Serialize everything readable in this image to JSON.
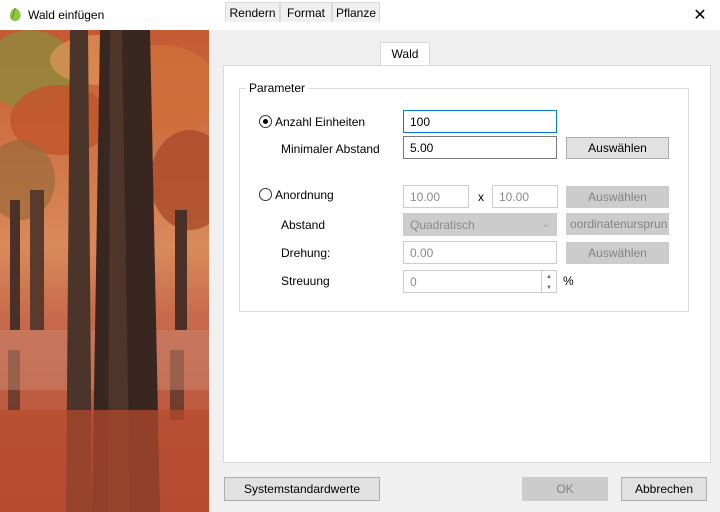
{
  "window": {
    "title": "Wald einfügen",
    "close_glyph": "✕",
    "icon": "leaf-icon"
  },
  "tabs": [
    {
      "label": "Rendern"
    },
    {
      "label": "Format"
    },
    {
      "label": "Pflanze"
    },
    {
      "label": "Wald",
      "active": true
    }
  ],
  "group": {
    "title": "Parameter",
    "anzahl": {
      "radio_label": "Anzahl Einheiten",
      "checked": true,
      "value": "100",
      "min_label": "Minimaler Abstand",
      "min_value": "5.00",
      "select_button": "Auswählen"
    },
    "anordnung": {
      "radio_label": "Anordnung",
      "checked": false,
      "x_value": "10.00",
      "x_sep": "x",
      "y_value": "10.00",
      "select_button": "Auswählen",
      "abstand_label": "Abstand",
      "abstand_value": "Quadratisch",
      "origin_button": "oordinatenursprun",
      "drehung_label": "Drehung:",
      "drehung_value": "0.00",
      "drehung_button": "Auswählen",
      "streuung_label": "Streuung",
      "streuung_value": "0",
      "streuung_unit": "%"
    }
  },
  "footer": {
    "defaults_button": "Systemstandardwerte",
    "ok_button": "OK",
    "cancel_button": "Abbrechen"
  },
  "colors": {
    "accent": "#0078d7",
    "leaf_green": "#8dc63f"
  }
}
